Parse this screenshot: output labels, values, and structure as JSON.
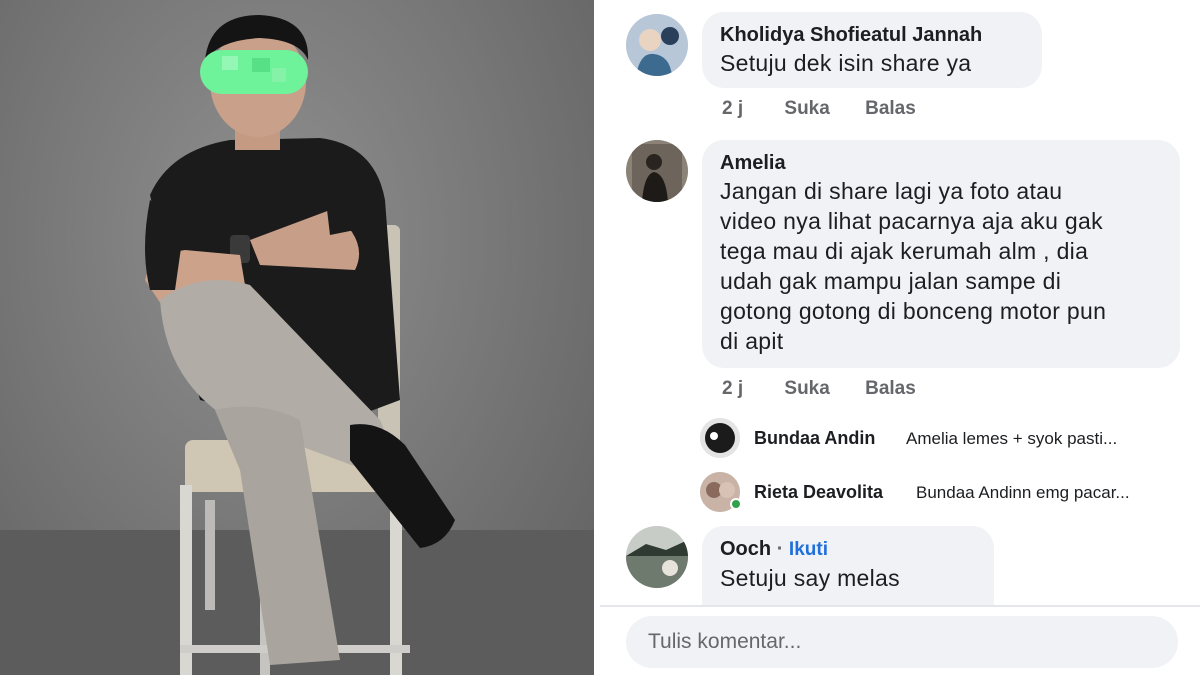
{
  "comments": [
    {
      "name": "Kholidya Shofieatul Jannah",
      "text": "Setuju dek isin share ya",
      "time": "2 j",
      "like": "Suka",
      "reply": "Balas"
    },
    {
      "name": "Amelia",
      "lines": [
        "Jangan di share lagi ya foto atau",
        "video nya lihat pacarnya aja aku gak",
        "tega mau di ajak kerumah alm , dia",
        "udah gak mampu jalan sampe di",
        "gotong gotong di bonceng motor pun",
        "di apit"
      ],
      "time": "2 j",
      "like": "Suka",
      "reply": "Balas",
      "replies": [
        {
          "name": "Bundaa Andin",
          "text": "Amelia lemes + syok pasti..."
        },
        {
          "name": "Rieta Deavolita",
          "text": "Bundaa Andinn emg pacar..."
        }
      ]
    },
    {
      "name": "Ooch",
      "separator": "·",
      "follow": "Ikuti",
      "text": "Setuju say melas"
    }
  ],
  "composer": {
    "placeholder": "Tulis komentar..."
  },
  "colors": {
    "bubble": "#f0f2f5",
    "link": "#216fdb",
    "meta": "#65676b",
    "blur_mask": "#6ef29a"
  }
}
